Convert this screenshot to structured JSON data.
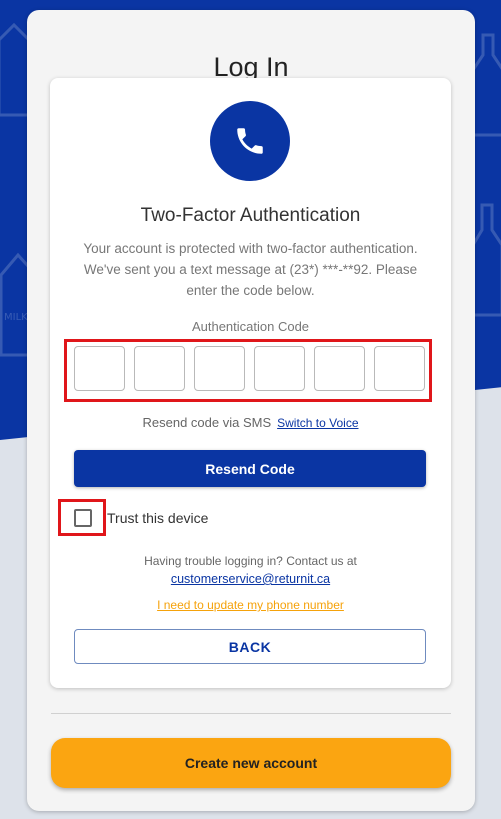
{
  "page": {
    "title": "Log In"
  },
  "two_factor": {
    "icon": "phone-icon",
    "title": "Two-Factor Authentication",
    "description": "Your account is protected with two-factor authentication. We've sent you a text message at (23*) ***-**92. Please enter the code below.",
    "code_label": "Authentication Code",
    "code_digits": [
      "",
      "",
      "",
      "",
      "",
      ""
    ]
  },
  "resend": {
    "text": "Resend code via SMS",
    "switch_link": "Switch to Voice",
    "button_label": "Resend Code"
  },
  "trust": {
    "label": "Trust this device",
    "checked": false
  },
  "support": {
    "text": "Having trouble logging in? Contact us at",
    "email": "customerservice@returnit.ca",
    "update_phone_link": "I need to update my phone number"
  },
  "actions": {
    "back_label": "BACK",
    "create_account_label": "Create new account"
  },
  "colors": {
    "primary": "#0a35a3",
    "accent": "#fba511",
    "highlight": "#e0161a",
    "background_gray": "#dde2ea"
  }
}
